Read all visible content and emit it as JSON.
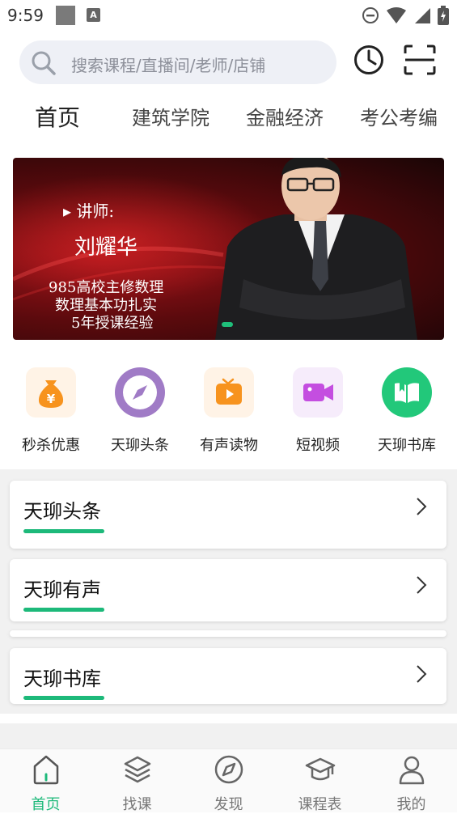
{
  "status_bar": {
    "time": "9:59",
    "notification_badge": "A"
  },
  "search": {
    "placeholder": "搜索课程/直播间/老师/店铺"
  },
  "header_icons": [
    "history-icon",
    "scan-icon"
  ],
  "tabs": [
    {
      "label": "首页",
      "active": true
    },
    {
      "label": "建筑学院",
      "active": false
    },
    {
      "label": "金融经济",
      "active": false
    },
    {
      "label": "考公考编",
      "active": false
    }
  ],
  "banner": {
    "label": "讲师:",
    "name": "刘耀华",
    "lines": [
      "985高校主修数理",
      "数理基本功扎实",
      "5年授课经验"
    ],
    "active_dot": 1
  },
  "quick_menu": [
    {
      "label": "秒杀优惠",
      "icon": "money-bag-icon",
      "color": "#f7931e"
    },
    {
      "label": "天珋头条",
      "icon": "compass-icon",
      "color": "#a07bc6"
    },
    {
      "label": "有声读物",
      "icon": "tv-play-icon",
      "color": "#f7931e"
    },
    {
      "label": "短视频",
      "icon": "video-camera-icon",
      "color": "#c44ee0"
    },
    {
      "label": "天珋书库",
      "icon": "book-icon",
      "color": "#22c87a"
    }
  ],
  "cards": [
    {
      "title": "天珋头条"
    },
    {
      "title": "天珋有声"
    },
    {
      "title": "天珋书库"
    }
  ],
  "bottom_nav": [
    {
      "label": "首页",
      "icon": "home-icon",
      "active": true
    },
    {
      "label": "找课",
      "icon": "layers-icon",
      "active": false
    },
    {
      "label": "发现",
      "icon": "compass-icon",
      "active": false
    },
    {
      "label": "课程表",
      "icon": "graduation-cap-icon",
      "active": false
    },
    {
      "label": "我的",
      "icon": "user-icon",
      "active": false
    }
  ],
  "colors": {
    "accent": "#1db97a",
    "search_bg": "#eef0f6"
  }
}
